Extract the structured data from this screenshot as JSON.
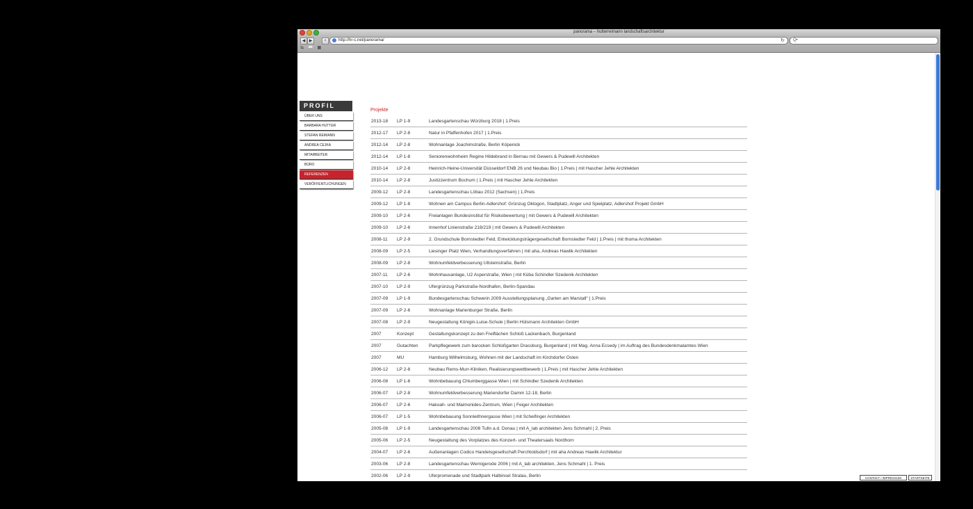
{
  "window": {
    "title": "panorama – hutterreimann landschaftsarchitektur",
    "url": "http://hr-c.net/panorama/",
    "search_placeholder": "Q•"
  },
  "sidebar": {
    "header": "PROFIL",
    "items": [
      {
        "label": "Über uns",
        "active": false
      },
      {
        "label": "Barbara Hutter",
        "active": false
      },
      {
        "label": "Stefan Reimann",
        "active": false
      },
      {
        "label": "Andrea Cejka",
        "active": false
      },
      {
        "label": "Mitarbeiter",
        "active": false
      },
      {
        "label": "Büro",
        "active": false
      },
      {
        "label": "Referenzen",
        "active": true
      },
      {
        "label": "Veröffentlichungen",
        "active": false
      }
    ]
  },
  "main": {
    "section_title": "Projekte",
    "projects": [
      {
        "year": "2013-18",
        "phase": "LP 1-9",
        "desc": "Landesgartenschau Würzburg 2018  |  1.Preis"
      },
      {
        "year": "2012-17",
        "phase": "LP 2-8",
        "desc": "Natur in Pfaffenhofen 2017  |  1.Preis"
      },
      {
        "year": "2012-14",
        "phase": "LP 2-8",
        "desc": "Wohnanlage Joachimstraße, Berlin Köpenick"
      },
      {
        "year": "2012-14",
        "phase": "LP 1-8",
        "desc": "Seniorenwohnheim Regine Hildebrand in Bernau mit Gewers & Pudewill Architekten"
      },
      {
        "year": "2010-14",
        "phase": "LP 2-8",
        "desc": "Heinrich-Heine-Universität Düsseldorf ENB 26 und Neubau Bio  |  1.Preis  |  mit Hascher Jehle Architekten"
      },
      {
        "year": "2010-14",
        "phase": "LP 2-8",
        "desc": "Justizzentrum Bochum  |  1.Preis  |  mit Hascher Jehle Architekten"
      },
      {
        "year": "2009-12",
        "phase": "LP 2-8",
        "desc": "Landesgartenschau Löbau 2012 (Sachsen)  |  1.Preis"
      },
      {
        "year": "2009-12",
        "phase": "LP 1-8",
        "desc": "Wohnen am Campus Berlin-Adlershof: Grünzug Oktogon, Stadtplatz, Anger und Spielplatz, Adlershof Projekt GmbH"
      },
      {
        "year": "2009-10",
        "phase": "LP 2-6",
        "desc": "Freianlagen Bundesinstitut für Risikobewertung  |  mit Gewers & Pudewill Architekten"
      },
      {
        "year": "2009-10",
        "phase": "LP 2-6",
        "desc": "Innenhof Linienstraße 218/219  |  mit Gewers & Pudewill Architekten"
      },
      {
        "year": "2008-11",
        "phase": "LP 2-9",
        "desc": "2. Grundschule Bornstedter Feld, Entwicklungsträgergesellschaft Bornstedter Feld  |  1.Preis  |  mit thoma Architekten"
      },
      {
        "year": "2008-09",
        "phase": "LP 2-5",
        "desc": "Liesinger Platz Wien, Verhandlungsverfahren  |  mit aha, Andreas Hawlik Architekten"
      },
      {
        "year": "2008-09",
        "phase": "LP 2-8",
        "desc": "Wohnumfeldverbesserung Ullsteinstraße, Berlin"
      },
      {
        "year": "2007-11",
        "phase": "LP 2-6",
        "desc": "Wohnhausanlage, U2 Asperstraße, Wien  |  mit Küba Schindler Szedenik Architekten"
      },
      {
        "year": "2007-10",
        "phase": "LP 2-9",
        "desc": "Ufergrünzug Parkstraße-Nordhafen, Berlin-Spandau"
      },
      {
        "year": "2007-09",
        "phase": "LP 1-9",
        "desc": "Bundesgartenschau Schwerin 2009 Ausstellungsplanung „Garten am Marstall“  |  1.Preis"
      },
      {
        "year": "2007-09",
        "phase": "LP 2-6",
        "desc": "Wohnanlage Marienburger Straße, Berlin"
      },
      {
        "year": "2007-08",
        "phase": "LP 2-9",
        "desc": "Neugestaltung Königin-Luise-Schule  |  Berlin Hülsmann Architekten GmbH"
      },
      {
        "year": "2007",
        "phase": "Konzept",
        "desc": "Gestaltungskonzept zu den Freiflächen Schloß Lackenbach, Burgenland"
      },
      {
        "year": "2007",
        "phase": "Gutachten",
        "desc": "Parkpflegewerk zum barocken Schloßgarten Drassburg, Burgenland  |  mit Mag. Anna Ecsedy  |  im Auftrag des Bundesdenkmalamtes Wien"
      },
      {
        "year": "2007",
        "phase": "MU",
        "desc": "Hamburg Wilhelmsburg, Wohnen mit der Landschaft im Kirchdorfer Osten"
      },
      {
        "year": "2006-12",
        "phase": "LP 2-8",
        "desc": "Neubau Rems-Murr-Kliniken, Realisierungswettbewerb  |  1.Preis  |  mit Hascher Jehle Architekten"
      },
      {
        "year": "2006-08",
        "phase": "LP 1-6",
        "desc": "Wohnbebauung Chlumberggasse Wien  |  mit Schindler Szedenik Architekten"
      },
      {
        "year": "2006-07",
        "phase": "LP 2-8",
        "desc": "Wohnumfeldverbesserung Mariendorfer Damm 12-18, Berlin"
      },
      {
        "year": "2006-07",
        "phase": "LP 2-6",
        "desc": "Hakoah- und Maimonides-Zentrum, Wien  |  Feiger Architekten"
      },
      {
        "year": "2006-07",
        "phase": "LP 1-5",
        "desc": "Wohnbebauung Sonnleithnergasse Wien  |  mit Scheifinger Architekten"
      },
      {
        "year": "2005-08",
        "phase": "LP 1-9",
        "desc": "Landesgartenschau 2008 Tulln a.d. Donau  |  mit A_lab architekten Jens Schmahl  |  2. Preis"
      },
      {
        "year": "2005-06",
        "phase": "LP 2-5",
        "desc": "Neugestaltung des Vorplatzes des Konzert- und Theatersaals Nordhorn"
      },
      {
        "year": "2004-07",
        "phase": "LP 2-6",
        "desc": "Außenanlagen Codico Handelsgesellschaft Perchtoldsdorf  |  mit aha Andreas Hawlik Architektur"
      },
      {
        "year": "2003-06",
        "phase": "LP 2-8",
        "desc": "Landesgartenschau Wernigerode 2006  |  mit A_lab architekten, Jens Schmahl  |  1. Preis"
      },
      {
        "year": "2002-06",
        "phase": "LP 2-9",
        "desc": "Uferpromenade und Stadtpark Halbinsel Stralau, Berlin"
      }
    ]
  },
  "footer": {
    "kontakt_label": "KONTAKT / IMPRESSUM",
    "start_label": "STARTSEITE"
  },
  "colors": {
    "accent": "#c8232c",
    "sidebar_header": "#3a3a3a"
  }
}
